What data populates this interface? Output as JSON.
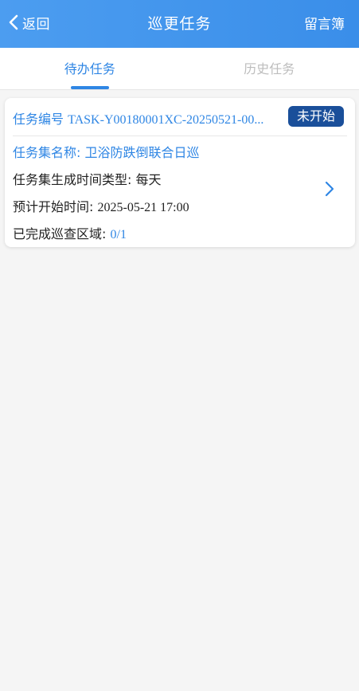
{
  "header": {
    "back_label": "返回",
    "title": "巡更任务",
    "right_label": "留言簿"
  },
  "tabs": [
    {
      "label": "待办任务",
      "active": true
    },
    {
      "label": "历史任务",
      "active": false
    }
  ],
  "task": {
    "number_label": "任务编号",
    "number_value": "TASK-Y00180001XC-20250521-00...",
    "status": "未开始",
    "set_name_label": "任务集名称:",
    "set_name_value": "卫浴防跌倒联合日巡",
    "gen_type_label": "任务集生成时间类型:",
    "gen_type_value": "每天",
    "start_time_label": "预计开始时间:",
    "start_time_value": "2025-05-21 17:00",
    "progress_label": "已完成巡查区域:",
    "progress_value": "0/1"
  },
  "colors": {
    "header_bg": "#3a8ee9",
    "accent": "#2f86e4",
    "badge_bg": "#1a4f9a",
    "page_bg": "#f5f5f5"
  },
  "icons": {
    "back": "chevron-left-icon",
    "card_arrow": "chevron-right-icon"
  }
}
